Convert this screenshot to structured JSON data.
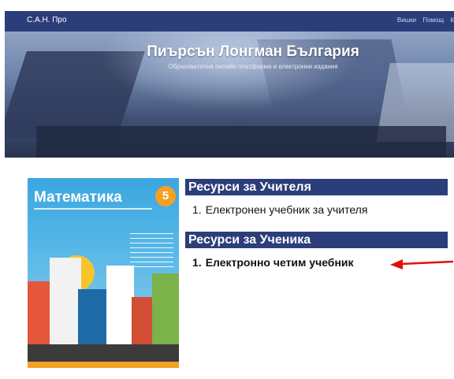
{
  "header": {
    "brand": "С.А.Н. Про",
    "nav": [
      "Вишки",
      "Помощ",
      "К"
    ]
  },
  "hero": {
    "title": "Пиърсън Лонгман България",
    "subtitle": "Образователна онлайн платформа и електронни издания"
  },
  "cover": {
    "title": "Математика",
    "grade": "5"
  },
  "teacher_section": {
    "heading": "Ресурси за Учителя",
    "items": [
      {
        "num": "1.",
        "label": "Електронен учебник за учителя"
      }
    ]
  },
  "student_section": {
    "heading": "Ресурси за Ученика",
    "items": [
      {
        "num": "1.",
        "label": "Електронно четим учебник"
      }
    ]
  },
  "colors": {
    "navbar": "#2c3e7a",
    "section_bar": "#2c3e7a",
    "arrow": "#e01010"
  }
}
